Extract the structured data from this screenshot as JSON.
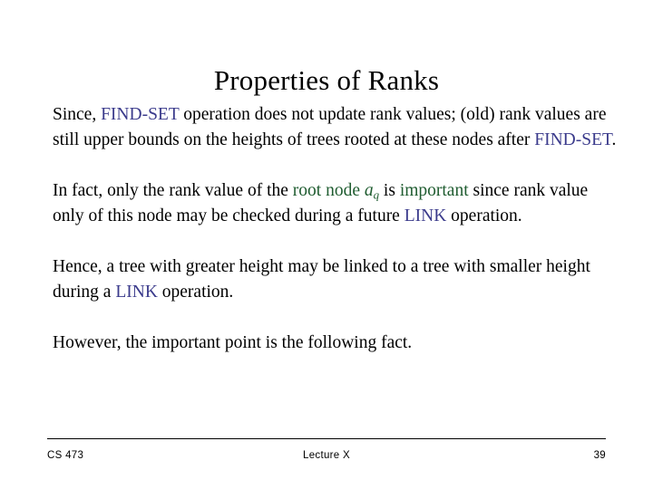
{
  "slide": {
    "title": "Properties of Ranks",
    "colors": {
      "keyword_purple": "#3b3b8c",
      "keyword_green": "#1f5c30",
      "text": "#000000",
      "background": "#ffffff"
    },
    "paragraphs": [
      {
        "id": "since-find-set",
        "segments": [
          {
            "text": "Since, ",
            "style": "plain"
          },
          {
            "text": "FIND-SET",
            "style": "purple"
          },
          {
            "text": " operation does not update rank values; (old) rank values are still upper bounds on the heights of trees rooted at these nodes after ",
            "style": "plain"
          },
          {
            "text": "FIND-SET",
            "style": "purple"
          },
          {
            "text": ".",
            "style": "plain"
          }
        ]
      },
      {
        "id": "in-fact-root-node",
        "segments": [
          {
            "text": "In fact, only the rank value of the ",
            "style": "plain"
          },
          {
            "text": "root node ",
            "style": "green"
          },
          {
            "text": "a",
            "subscript": "q",
            "style": "green-italic-math"
          },
          {
            "text": " is ",
            "style": "plain"
          },
          {
            "text": "important",
            "style": "green"
          },
          {
            "text": " since rank value only of this node may be checked during a future ",
            "style": "plain"
          },
          {
            "text": "LINK",
            "style": "purple"
          },
          {
            "text": " operation.",
            "style": "plain"
          }
        ]
      },
      {
        "id": "hence-tree-height",
        "segments": [
          {
            "text": "Hence, a tree with greater height may be linked to a tree with smaller height during a ",
            "style": "plain"
          },
          {
            "text": "LINK",
            "style": "purple"
          },
          {
            "text": " operation.",
            "style": "plain"
          }
        ]
      },
      {
        "id": "however-important-point",
        "segments": [
          {
            "text": "However, the important point is the following fact.",
            "style": "plain"
          }
        ]
      }
    ],
    "paragraph_text": {
      "p1_a": "Since, ",
      "p1_kw1": "FIND-SET",
      "p1_b": " operation does not update rank values; (old) rank values are still upper bounds on the heights of trees rooted at these nodes after ",
      "p1_kw2": "FIND-SET",
      "p1_c": ".",
      "p2_a": "In fact, only the rank value of the ",
      "p2_kw1": "root node ",
      "p2_var": "a",
      "p2_var_sub": "q",
      "p2_b": " is ",
      "p2_kw2": "important",
      "p2_c": " since rank value only of this node may be checked during a future ",
      "p2_kw3": "LINK",
      "p2_d": " operation.",
      "p3_a": "Hence, a tree with greater height may be linked to a tree with smaller height during a ",
      "p3_kw1": "LINK",
      "p3_b": " operation.",
      "p4_a": "However, the important point is the following fact."
    },
    "footer": {
      "course": "CS 473",
      "lecture": "Lecture X",
      "page_number": "39"
    }
  }
}
